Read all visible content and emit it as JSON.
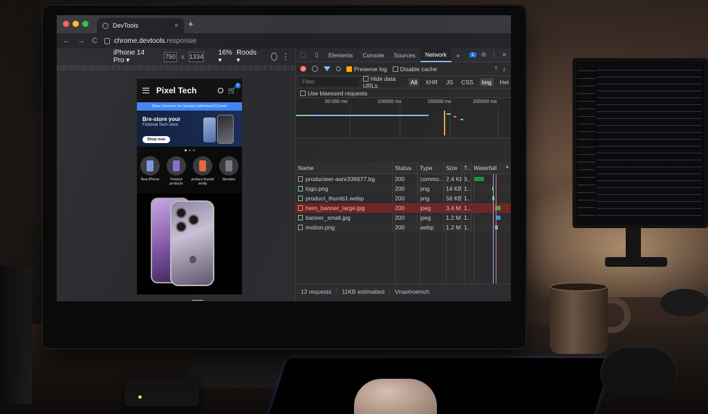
{
  "browser": {
    "tab_title": "DevTools",
    "tab_close": "×",
    "new_tab": "+",
    "url_host": "chrome.devtools.",
    "url_rest": "responsie",
    "nav_back": "←",
    "nav_forward": "→",
    "nav_reload": "C"
  },
  "device_toolbar": {
    "device": "iPhone 14 Pro ▾",
    "width": "750",
    "height": "1334",
    "times": "x",
    "zoom": "16% ▾",
    "throttle": "Roods ▾",
    "more": "⋮"
  },
  "phone": {
    "brand": "Pixel Tech",
    "cart_count": "0",
    "promo": "Store Sorenen for Sewent tobilndond Consel",
    "hero_title": "Bre-store your",
    "hero_subtitle": "Fictional Tech store",
    "shop_button": "Shop now",
    "categories": [
      {
        "label": "New iPhone",
        "color": "#7a9ad8"
      },
      {
        "label": "Product products",
        "color": "#8c6dc8"
      },
      {
        "label": "product thumbl sevllp",
        "color": "#e06b3a"
      },
      {
        "label": "Nendsrs",
        "color": "#7a7a82"
      }
    ]
  },
  "devtools": {
    "tabs": [
      "Elements",
      "Console",
      "Sources",
      "Network"
    ],
    "active_tab": "Network",
    "more_tabs": "»",
    "badge": "1",
    "preserve_log": "Preserve log",
    "disable_cache": "Disable cache",
    "filter_placeholder": "Filter",
    "hide_data_urls": "Hide data URLs",
    "type_filters": [
      "All",
      "XHR",
      "JS",
      "CSS",
      "Img",
      "Het"
    ],
    "use_blocked": "Use blaessed requests",
    "ticks": [
      "50:000 ms",
      "100000 ms",
      "150000 ms",
      "200000 ms"
    ],
    "columns": [
      "Name",
      "Status",
      "Type",
      "Size",
      "T...",
      "Waterfall"
    ],
    "rows": [
      {
        "name": "producieer-aanr336677.bg",
        "status": "200",
        "type": "commo...",
        "size": "2.4 KB",
        "time": "6...",
        "kind": "doc"
      },
      {
        "name": "logo.png",
        "status": "200",
        "type": "png",
        "size": "14 KB",
        "time": "1...",
        "kind": "img"
      },
      {
        "name": "product_thumb1.webp",
        "status": "200",
        "type": "png",
        "size": "56 KB",
        "time": "1...",
        "kind": "img"
      },
      {
        "name": "hero_banner_large.jpg",
        "status": "200",
        "type": "jpeg",
        "size": "3.4 MB",
        "time": "1...",
        "kind": "err"
      },
      {
        "name": "banner_small.jpg",
        "status": "200",
        "type": "jpeg",
        "size": "1.2 MB",
        "time": "1...",
        "kind": "img"
      },
      {
        "name": "motion.png",
        "status": "200",
        "type": "webp",
        "size": "1.2 MB",
        "time": "1...",
        "kind": "doc"
      }
    ],
    "status_requests": "12 requests",
    "status_transferred": "11KB estimatted",
    "status_other": "Vnaohoemch"
  },
  "colors": {
    "accent": "#8ab4f8",
    "error_row": "#6b2222",
    "record": "#e53935"
  }
}
